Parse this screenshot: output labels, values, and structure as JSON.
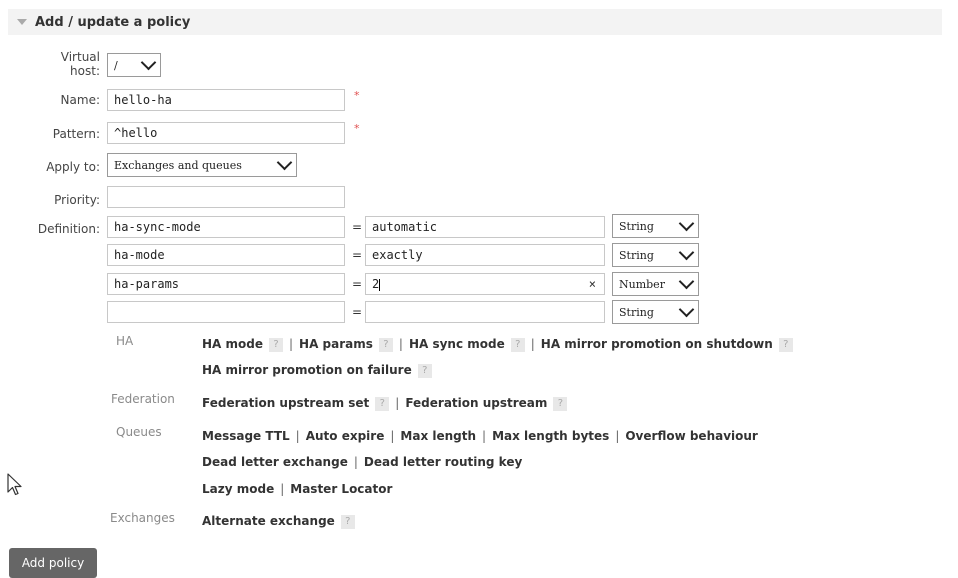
{
  "section": {
    "title": "Add / update a policy"
  },
  "form": {
    "vhost_label": "Virtual host:",
    "vhost_value": "/",
    "name_label": "Name:",
    "name_value": "hello-ha",
    "pattern_label": "Pattern:",
    "pattern_value": "^hello",
    "required_mark": "*",
    "apply_label": "Apply to:",
    "apply_value": "Exchanges and queues",
    "priority_label": "Priority:",
    "priority_value": "",
    "definition_label": "Definition:"
  },
  "definition_rows": [
    {
      "key": "ha-sync-mode",
      "value": "automatic",
      "type": "String"
    },
    {
      "key": "ha-mode",
      "value": "exactly",
      "type": "String"
    },
    {
      "key": "ha-params",
      "value": "2",
      "type": "Number",
      "clear": "×"
    },
    {
      "key": "",
      "value": "",
      "type": "String"
    }
  ],
  "equals": "=",
  "categories": {
    "ha": {
      "label": "HA",
      "links": [
        "HA mode",
        "HA params",
        "HA sync mode",
        "HA mirror promotion on shutdown",
        "HA mirror promotion on failure"
      ]
    },
    "federation": {
      "label": "Federation",
      "links": [
        "Federation upstream set",
        "Federation upstream"
      ]
    },
    "queues": {
      "label": "Queues",
      "links": [
        "Message TTL",
        "Auto expire",
        "Max length",
        "Max length bytes",
        "Overflow behaviour",
        "Dead letter exchange",
        "Dead letter routing key",
        "Lazy mode",
        "Master Locator"
      ]
    },
    "exchanges": {
      "label": "Exchanges",
      "links": [
        "Alternate exchange"
      ]
    }
  },
  "help_glyph": "?",
  "separator": "|",
  "button": {
    "label": "Add policy"
  }
}
